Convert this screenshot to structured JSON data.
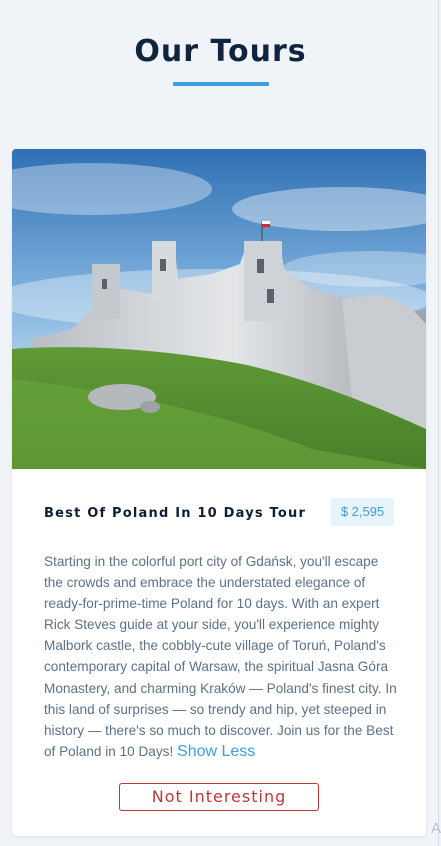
{
  "header": {
    "title": "Our Tours"
  },
  "tour": {
    "image_alt": "Ogrodzieniec castle ruins on a grassy hill under a blue sky",
    "title": "Best Of Poland In 10 Days Tour",
    "price": "$ 2,595",
    "description": "Starting in the colorful port city of Gdańsk, you'll escape the crowds and embrace the understated elegance of ready-for-prime-time Poland for 10 days. With an expert Rick Steves guide at your side, you'll experience mighty Malbork castle, the cobbly-cute village of Toruń, Poland's contemporary capital of Warsaw, the spiritual Jasna Góra Monastery, and charming Kraków — Poland's finest city. In this land of surprises — so trendy and hip, yet steeped in history — there's so much to discover. Join us for the Best of Poland in 10 Days!",
    "toggle_label": "Show Less",
    "dismiss_label": "Not Interesting"
  },
  "colors": {
    "accent": "#3d9ee0",
    "danger": "#b83a3a",
    "title": "#10253d",
    "background": "#f0f3f7"
  },
  "corner_glyph": "A"
}
